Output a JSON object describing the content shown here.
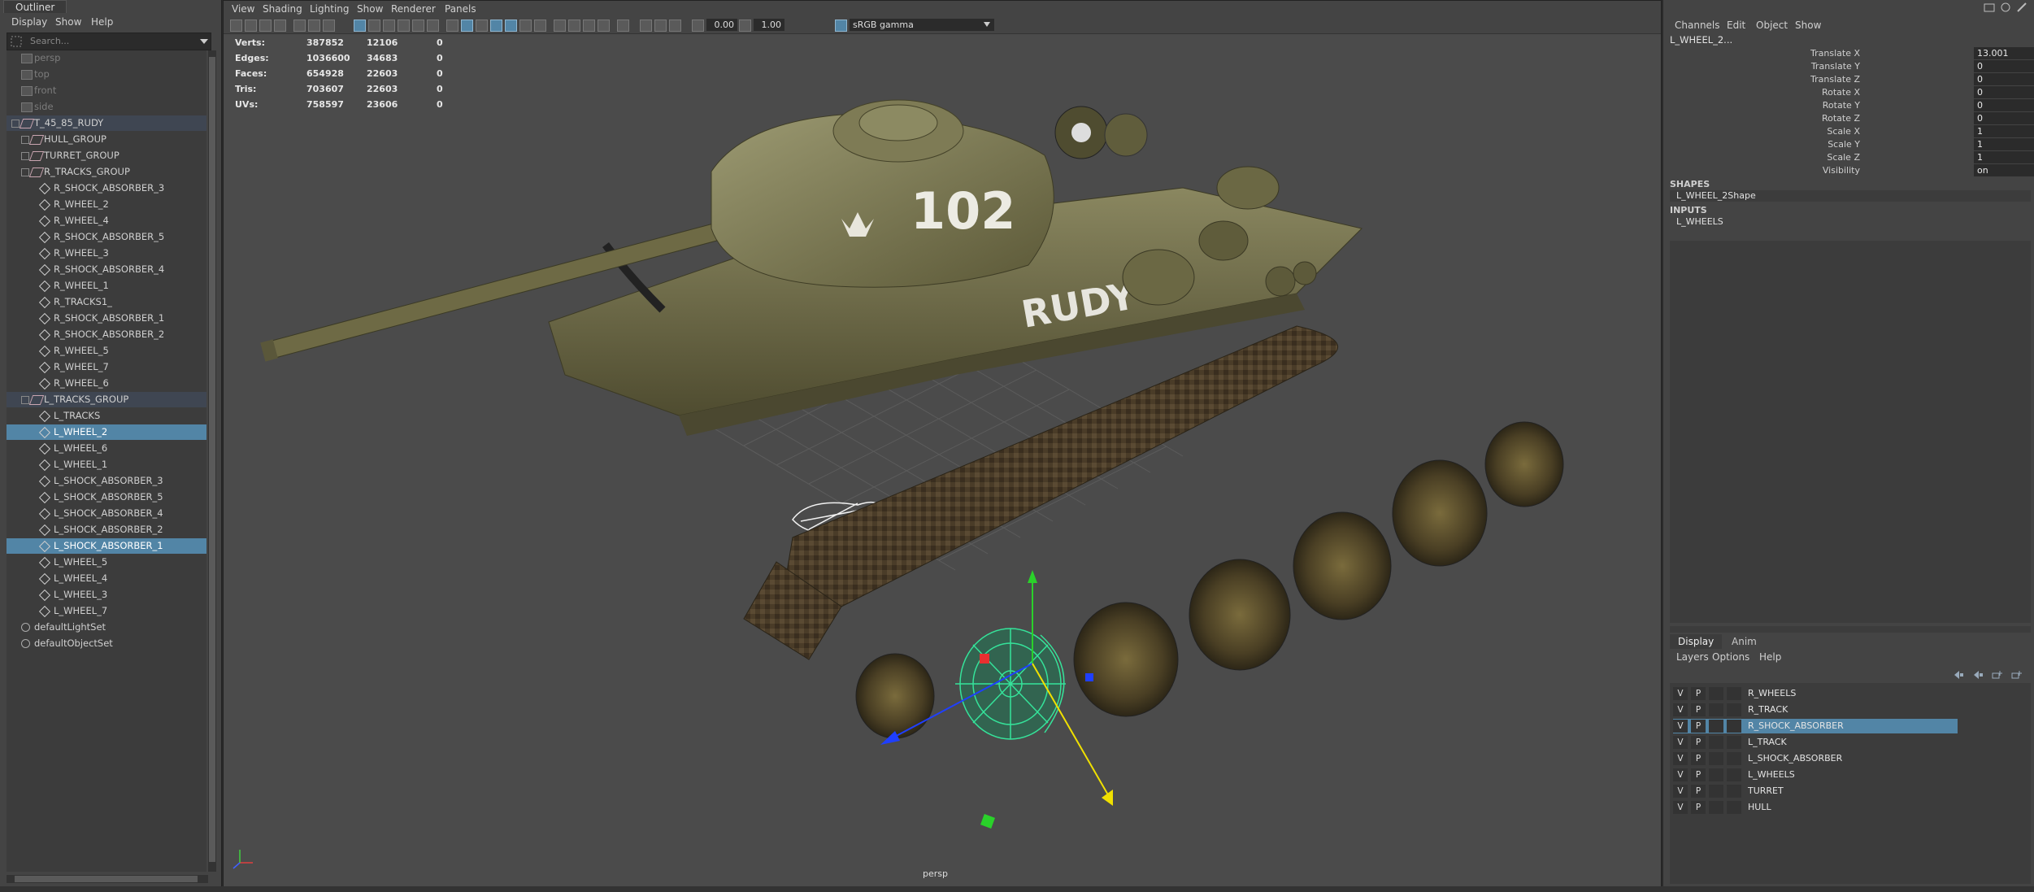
{
  "outliner": {
    "tab": "Outliner",
    "menu": [
      "Display",
      "Show",
      "Help"
    ],
    "search_placeholder": "Search...",
    "items": [
      {
        "label": "persp",
        "kind": "camera",
        "depth": 1
      },
      {
        "label": "top",
        "kind": "camera",
        "depth": 1
      },
      {
        "label": "front",
        "kind": "camera",
        "depth": 1
      },
      {
        "label": "side",
        "kind": "camera",
        "depth": 1
      },
      {
        "label": "T_45_85_RUDY",
        "kind": "group",
        "depth": 1,
        "state": "group"
      },
      {
        "label": "HULL_GROUP",
        "kind": "group",
        "depth": 2
      },
      {
        "label": "TURRET_GROUP",
        "kind": "group",
        "depth": 2
      },
      {
        "label": "R_TRACKS_GROUP",
        "kind": "group",
        "depth": 2
      },
      {
        "label": "R_SHOCK_ABSORBER_3",
        "kind": "mesh",
        "depth": 3
      },
      {
        "label": "R_WHEEL_2",
        "kind": "mesh",
        "depth": 3
      },
      {
        "label": "R_WHEEL_4",
        "kind": "mesh",
        "depth": 3
      },
      {
        "label": "R_SHOCK_ABSORBER_5",
        "kind": "mesh",
        "depth": 3
      },
      {
        "label": "R_WHEEL_3",
        "kind": "mesh",
        "depth": 3
      },
      {
        "label": "R_SHOCK_ABSORBER_4",
        "kind": "mesh",
        "depth": 3
      },
      {
        "label": "R_WHEEL_1",
        "kind": "mesh",
        "depth": 3
      },
      {
        "label": "R_TRACKS1_",
        "kind": "mesh",
        "depth": 3
      },
      {
        "label": "R_SHOCK_ABSORBER_1",
        "kind": "mesh",
        "depth": 3
      },
      {
        "label": "R_SHOCK_ABSORBER_2",
        "kind": "mesh",
        "depth": 3
      },
      {
        "label": "R_WHEEL_5",
        "kind": "mesh",
        "depth": 3
      },
      {
        "label": "R_WHEEL_7",
        "kind": "mesh",
        "depth": 3
      },
      {
        "label": "R_WHEEL_6",
        "kind": "mesh",
        "depth": 3
      },
      {
        "label": "L_TRACKS_GROUP",
        "kind": "group",
        "depth": 2,
        "state": "group"
      },
      {
        "label": "L_TRACKS",
        "kind": "mesh",
        "depth": 3
      },
      {
        "label": "L_WHEEL_2",
        "kind": "mesh",
        "depth": 3,
        "state": "selected"
      },
      {
        "label": "L_WHEEL_6",
        "kind": "mesh",
        "depth": 3
      },
      {
        "label": "L_WHEEL_1",
        "kind": "mesh",
        "depth": 3
      },
      {
        "label": "L_SHOCK_ABSORBER_3",
        "kind": "mesh",
        "depth": 3
      },
      {
        "label": "L_SHOCK_ABSORBER_5",
        "kind": "mesh",
        "depth": 3
      },
      {
        "label": "L_SHOCK_ABSORBER_4",
        "kind": "mesh",
        "depth": 3
      },
      {
        "label": "L_SHOCK_ABSORBER_2",
        "kind": "mesh",
        "depth": 3
      },
      {
        "label": "L_SHOCK_ABSORBER_1",
        "kind": "mesh",
        "depth": 3,
        "state": "selected"
      },
      {
        "label": "L_WHEEL_5",
        "kind": "mesh",
        "depth": 3
      },
      {
        "label": "L_WHEEL_4",
        "kind": "mesh",
        "depth": 3
      },
      {
        "label": "L_WHEEL_3",
        "kind": "mesh",
        "depth": 3
      },
      {
        "label": "L_WHEEL_7",
        "kind": "mesh",
        "depth": 3
      },
      {
        "label": "defaultLightSet",
        "kind": "set",
        "depth": 1
      },
      {
        "label": "defaultObjectSet",
        "kind": "set",
        "depth": 1
      }
    ]
  },
  "viewport": {
    "menu": [
      "View",
      "Shading",
      "Lighting",
      "Show",
      "Renderer",
      "Panels"
    ],
    "exposure": "0.00",
    "gamma_value": "1.00",
    "color_space": "sRGB gamma",
    "camera_label": "persp",
    "hud": [
      {
        "name": "Verts:",
        "a": "387852",
        "b": "12106",
        "c": "0"
      },
      {
        "name": "Edges:",
        "a": "1036600",
        "b": "34683",
        "c": "0"
      },
      {
        "name": "Faces:",
        "a": "654928",
        "b": "22603",
        "c": "0"
      },
      {
        "name": "Tris:",
        "a": "703607",
        "b": "22603",
        "c": "0"
      },
      {
        "name": "UVs:",
        "a": "758597",
        "b": "23606",
        "c": "0"
      }
    ],
    "decals": {
      "number": "102",
      "name": "RUDY"
    },
    "colors": {
      "bg": "#4b4b4b",
      "grid": "#5e5e5e",
      "tank": "#6f6c45",
      "track": "#4a3c28",
      "selection": "#35e39a"
    }
  },
  "channel_box": {
    "menu": [
      "Channels",
      "Edit",
      "Object",
      "Show"
    ],
    "object_name": "L_WHEEL_2...",
    "attributes": [
      {
        "name": "Translate X",
        "value": "13.001"
      },
      {
        "name": "Translate Y",
        "value": "0"
      },
      {
        "name": "Translate Z",
        "value": "0"
      },
      {
        "name": "Rotate X",
        "value": "0"
      },
      {
        "name": "Rotate Y",
        "value": "0"
      },
      {
        "name": "Rotate Z",
        "value": "0"
      },
      {
        "name": "Scale X",
        "value": "1"
      },
      {
        "name": "Scale Y",
        "value": "1"
      },
      {
        "name": "Scale Z",
        "value": "1"
      },
      {
        "name": "Visibility",
        "value": "on"
      }
    ],
    "shapes_label": "SHAPES",
    "shape_name": "L_WHEEL_2Shape",
    "inputs_label": "INPUTS",
    "input_name": "L_WHEELS"
  },
  "layer_editor": {
    "tabs": [
      "Display",
      "Anim"
    ],
    "menu": [
      "Layers",
      "Options",
      "Help"
    ],
    "layers": [
      {
        "v": "V",
        "p": "P",
        "name": "R_WHEELS"
      },
      {
        "v": "V",
        "p": "P",
        "name": "R_TRACK"
      },
      {
        "v": "V",
        "p": "P",
        "name": "R_SHOCK_ABSORBER",
        "selected": true
      },
      {
        "v": "V",
        "p": "P",
        "name": "L_TRACK"
      },
      {
        "v": "V",
        "p": "P",
        "name": "L_SHOCK_ABSORBER"
      },
      {
        "v": "V",
        "p": "P",
        "name": "L_WHEELS"
      },
      {
        "v": "V",
        "p": "P",
        "name": "TURRET"
      },
      {
        "v": "V",
        "p": "P",
        "name": "HULL"
      }
    ]
  }
}
